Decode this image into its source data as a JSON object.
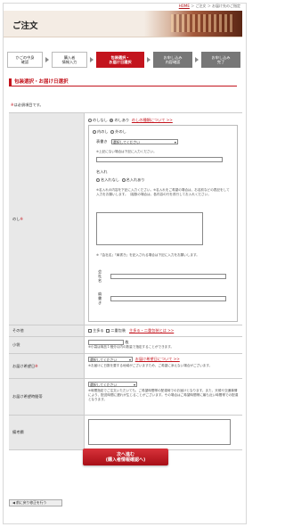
{
  "breadcrumb": {
    "home": "HOME",
    "sep1": "＞",
    "item1": "ご注文",
    "sep2": "＞",
    "item2": "お届け先のご指定"
  },
  "header": {
    "title": "ご注文"
  },
  "steps": [
    {
      "line1": "かごの中身",
      "line2": "確認"
    },
    {
      "line1": "購入者",
      "line2": "情報入力"
    },
    {
      "line1": "包装選択・",
      "line2": "お届け日選択"
    },
    {
      "line1": "お申し込み",
      "line2": "内容確認"
    },
    {
      "line1": "お申し込み",
      "line2": "完了"
    }
  ],
  "section_title": "包装選択・お届け日選択",
  "required_note_star": "※",
  "required_note": "は必須項目です。",
  "noshi": {
    "label": "のし",
    "opt_none": "のしなし",
    "opt_yes": "のしあり",
    "types_link": "のしの種類について >>",
    "uchi": "内のし",
    "soto": "外のし",
    "omote_label": "表書き",
    "omote_select": "選択してください",
    "omote_note": "※上記にない場合は下記に入力ください。",
    "name_label": "名入れ",
    "name_none": "名入れなし",
    "name_yes": "名入れあり",
    "name_note": "※名入れの内容を下記に入力ください。※名入れをご希望の場合は、お名前などの表記をして入力をお願いします。（複数の場合は、各内容の行を改行してお入れください。",
    "company_note": "※「会社名」「肩書き」を記入される場合は下記に入力をお願いします。",
    "company_label": "会社名",
    "title_label": "肩書き"
  },
  "other": {
    "label": "その他",
    "shoulder": "主多る",
    "double": "二重包装",
    "link": "主多る・二重包装とは >>"
  },
  "count": {
    "label": "小袋",
    "unit": "枚",
    "note": "※小袋は商品１個分以内の数量で指定することができます。"
  },
  "delivery_date": {
    "label": "お届け希望日",
    "select": "選択してください",
    "link": "お届け希望日について >>",
    "note": "※お届けに日数を要する地域がございますため、ご希望に添えない場合がございます。"
  },
  "delivery_time": {
    "label": "お届け希望時間帯",
    "select": "選択してください",
    "note": "※時間指定でご注文いただいても、ご希望時間帯の配達時でのお届けとなります。また、天候や交通事情により、配送時間に遅れが生じることがございます。その場合はご希望時間帯に最も近い時間帯での配達となります。"
  },
  "remarks": {
    "label": "備考欄"
  },
  "next_button": {
    "line1": "次へ進む",
    "line2": "(購入者情報確認へ)"
  },
  "back_button": "◀ 前に戻り修正を行う"
}
